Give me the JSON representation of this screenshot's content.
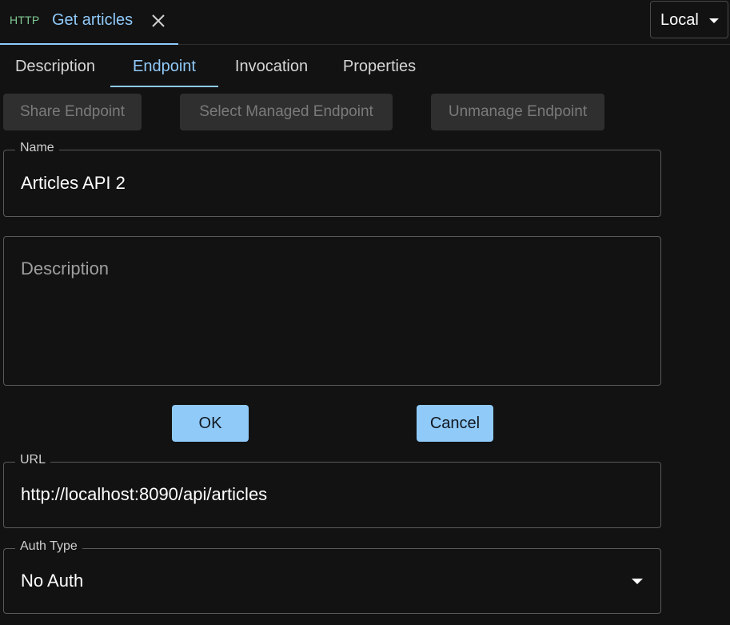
{
  "request_tab": {
    "method": "HTTP",
    "title": "Get articles",
    "method_color": "#81c995",
    "accent": "#90caf9",
    "close_icon": "close-icon"
  },
  "environment": {
    "selected": "Local",
    "icon": "caret-down-icon"
  },
  "section_tabs": [
    {
      "label": "Description",
      "active": false
    },
    {
      "label": "Endpoint",
      "active": true
    },
    {
      "label": "Invocation",
      "active": false
    },
    {
      "label": "Properties",
      "active": false
    }
  ],
  "endpoint_buttons": {
    "share": "Share Endpoint",
    "select_managed": "Select Managed Endpoint",
    "unmanage": "Unmanage Endpoint",
    "disabled": true
  },
  "name_field": {
    "label": "Name",
    "value": "Articles API 2"
  },
  "description_field": {
    "placeholder": "Description",
    "value": ""
  },
  "actions": {
    "ok": "OK",
    "cancel": "Cancel"
  },
  "url_field": {
    "label": "URL",
    "value": "http://localhost:8090/api/articles"
  },
  "auth_field": {
    "label": "Auth Type",
    "value": "No Auth",
    "icon": "caret-down-icon"
  }
}
